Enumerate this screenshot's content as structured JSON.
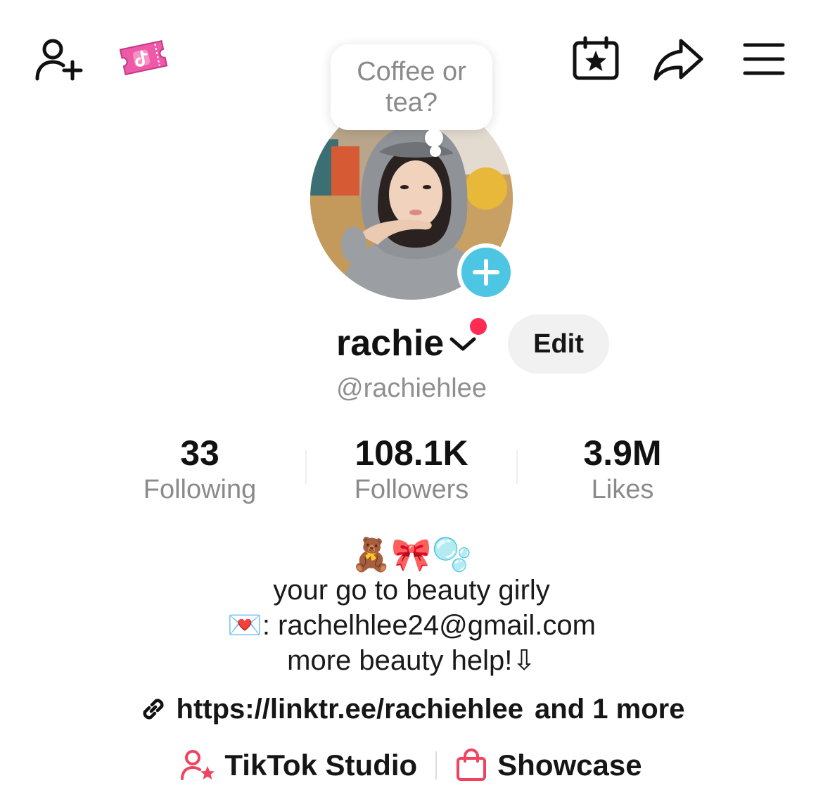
{
  "top_bar": {
    "add_friends_icon": "person-plus-icon",
    "ticket_icon": "tiktok-ticket-icon",
    "calendar_icon": "calendar-star-icon",
    "share_icon": "share-arrow-icon",
    "menu_icon": "hamburger-menu-icon"
  },
  "note_bubble": {
    "text": "Coffee or tea?"
  },
  "profile": {
    "display_name": "rachie",
    "username": "@rachiehlee",
    "edit_label": "Edit",
    "add_story_icon": "plus-icon",
    "notification_dot_color": "#fe2c55"
  },
  "stats": [
    {
      "value": "33",
      "label": "Following"
    },
    {
      "value": "108.1K",
      "label": "Followers"
    },
    {
      "value": "3.9M",
      "label": "Likes"
    }
  ],
  "bio": {
    "emoji_line": "🧸🎀🫧",
    "line1": "your go to beauty girly",
    "email_emoji": "💌",
    "line2": ": rachelhlee24@gmail.com",
    "line3": "more beauty help!⇩"
  },
  "links": {
    "url": "https://linktr.ee/rachiehlee",
    "more": "and 1 more"
  },
  "actions": {
    "studio_label": "TikTok Studio",
    "showcase_label": "Showcase"
  },
  "colors": {
    "accent_red": "#fe2c55",
    "story_plus": "#4cc6e2",
    "secondary_text": "#8a8a8a",
    "ticket_pink": "#ee5aa8"
  }
}
